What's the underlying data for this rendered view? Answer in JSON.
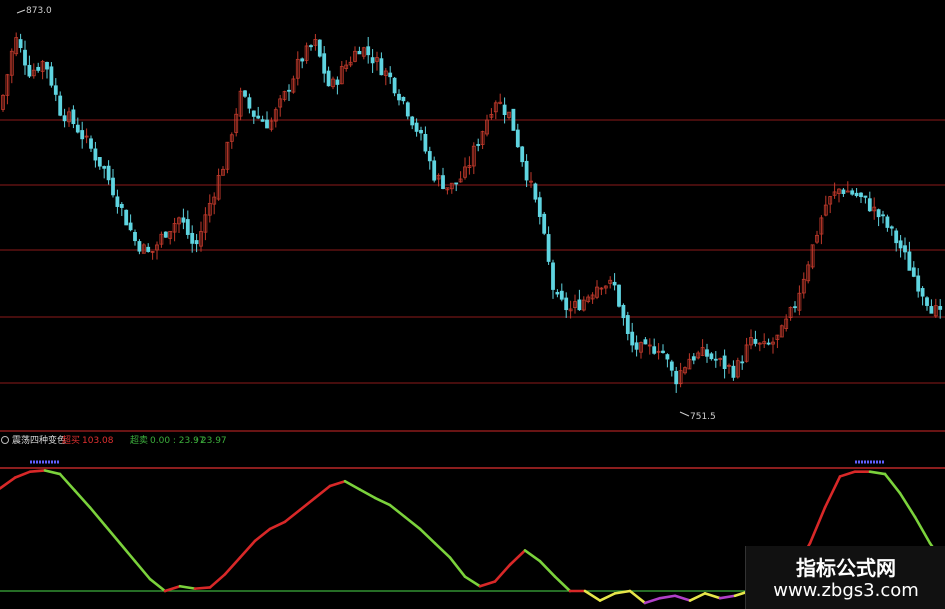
{
  "price_panel": {
    "high_label": "873.0",
    "low_label": "751.5"
  },
  "indicator_panel": {
    "name": "震荡四种变色",
    "buy_label": "超买",
    "buy_value": "103.08",
    "sell_label": "超卖",
    "sell_values": "0.00 : 23.97",
    "extra_value": ": 23.97"
  },
  "watermark": {
    "title": "指标公式网",
    "url": "www.zbgs3.com"
  },
  "colors": {
    "background": "#000000",
    "candle_up": "#c0392b",
    "candle_down": "#5fd4e0",
    "grid_line": "#8b1a1a",
    "overbought_line": "#e03030",
    "oversold_line": "#3cae3c",
    "osc_rising": "#d82828",
    "osc_falling": "#7bd23c",
    "osc_oversold": "#e6e64a",
    "osc_bottom": "#b040c8",
    "osc_top": "#6060ff"
  },
  "chart_data": [
    {
      "type": "candlestick",
      "title": "",
      "ylim": [
        740,
        880
      ],
      "high_marker": 873.0,
      "low_marker": 751.5,
      "close_path": [
        [
          0,
          845
        ],
        [
          15,
          870
        ],
        [
          30,
          858
        ],
        [
          45,
          862
        ],
        [
          60,
          845
        ],
        [
          75,
          840
        ],
        [
          90,
          832
        ],
        [
          105,
          824
        ],
        [
          120,
          812
        ],
        [
          135,
          800
        ],
        [
          150,
          795
        ],
        [
          165,
          803
        ],
        [
          180,
          808
        ],
        [
          195,
          797
        ],
        [
          210,
          813
        ],
        [
          225,
          828
        ],
        [
          240,
          850
        ],
        [
          255,
          843
        ],
        [
          270,
          840
        ],
        [
          285,
          850
        ],
        [
          300,
          862
        ],
        [
          315,
          868
        ],
        [
          330,
          852
        ],
        [
          345,
          860
        ],
        [
          360,
          867
        ],
        [
          375,
          862
        ],
        [
          390,
          856
        ],
        [
          405,
          847
        ],
        [
          420,
          836
        ],
        [
          435,
          822
        ],
        [
          450,
          818
        ],
        [
          465,
          823
        ],
        [
          480,
          836
        ],
        [
          495,
          849
        ],
        [
          510,
          843
        ],
        [
          525,
          825
        ],
        [
          540,
          808
        ],
        [
          555,
          780
        ],
        [
          570,
          776
        ],
        [
          585,
          780
        ],
        [
          600,
          786
        ],
        [
          615,
          784
        ],
        [
          630,
          764
        ],
        [
          645,
          762
        ],
        [
          660,
          764
        ],
        [
          675,
          752
        ],
        [
          690,
          760
        ],
        [
          705,
          761
        ],
        [
          720,
          758
        ],
        [
          735,
          755
        ],
        [
          750,
          765
        ],
        [
          765,
          763
        ],
        [
          780,
          767
        ],
        [
          795,
          778
        ],
        [
          810,
          795
        ],
        [
          825,
          812
        ],
        [
          840,
          818
        ],
        [
          855,
          816
        ],
        [
          870,
          812
        ],
        [
          885,
          806
        ],
        [
          900,
          798
        ],
        [
          915,
          787
        ],
        [
          930,
          778
        ],
        [
          945,
          772
        ]
      ]
    },
    {
      "type": "line",
      "title": "震荡四种变色",
      "ylim": [
        -5,
        110
      ],
      "overbought": 103.08,
      "oversold": 0.0,
      "series": [
        {
          "x": [
            0,
            15,
            30,
            45,
            60,
            75,
            90,
            105,
            120,
            135,
            150,
            165,
            180,
            195,
            210,
            225,
            240,
            255,
            270,
            285,
            300,
            315,
            330,
            345,
            360,
            375,
            390,
            405,
            420,
            435,
            450,
            465,
            480,
            495,
            510,
            525,
            540,
            555,
            570,
            585,
            600,
            615,
            630,
            645,
            660,
            675,
            690,
            705,
            720,
            735,
            750,
            765,
            780,
            795,
            810,
            825,
            840,
            855,
            870,
            885,
            900,
            915,
            930,
            945
          ],
          "values": [
            86,
            95,
            100,
            101,
            98,
            84,
            70,
            55,
            40,
            25,
            10,
            0,
            4,
            2,
            3,
            14,
            28,
            42,
            52,
            58,
            68,
            78,
            88,
            92,
            85,
            78,
            72,
            62,
            52,
            40,
            28,
            12,
            4,
            8,
            22,
            34,
            25,
            12,
            0,
            0,
            -8,
            -2,
            0,
            -10,
            -6,
            -4,
            -8,
            -2,
            -6,
            -4,
            0,
            5,
            8,
            18,
            40,
            70,
            96,
            100,
            100,
            98,
            82,
            62,
            40,
            22
          ]
        }
      ]
    }
  ]
}
